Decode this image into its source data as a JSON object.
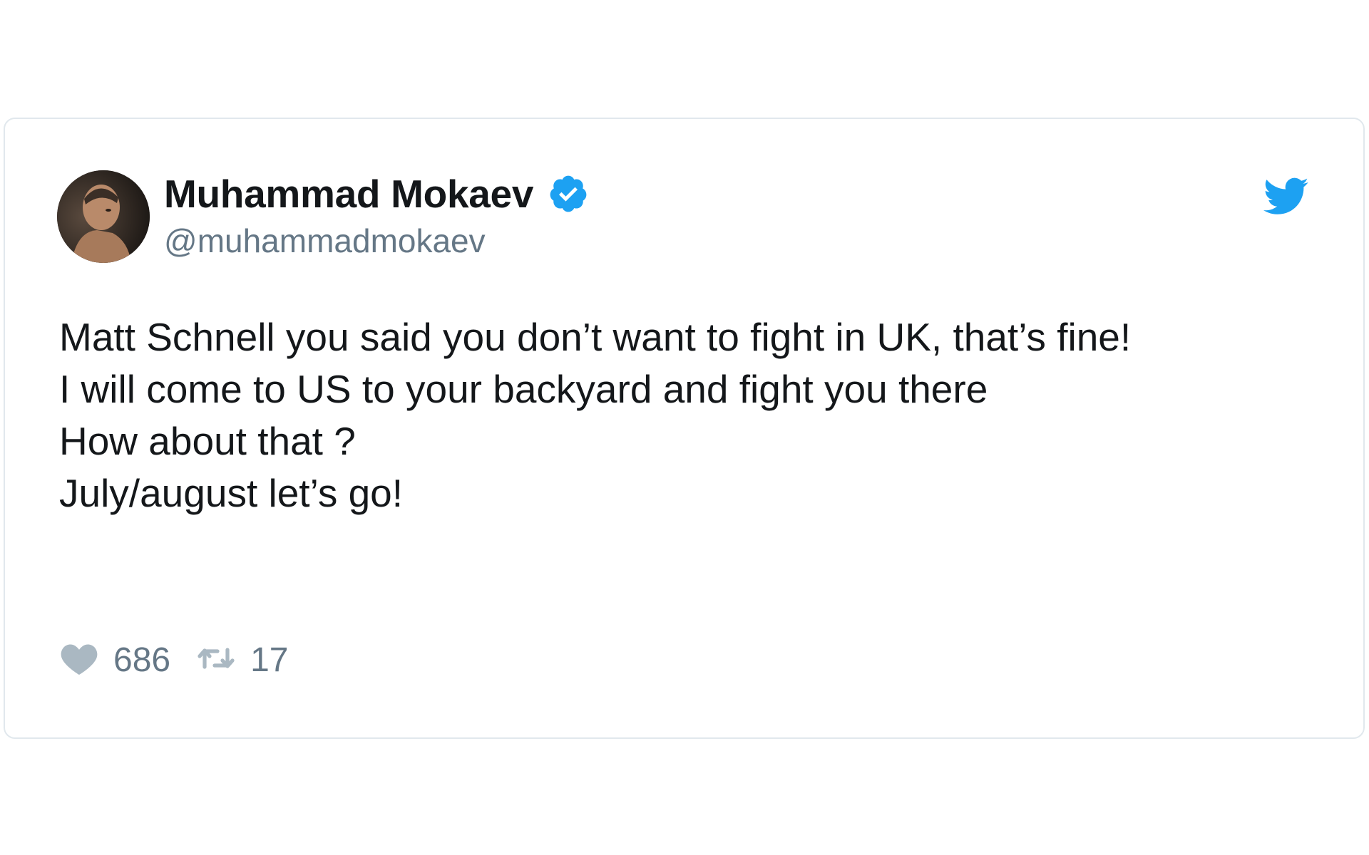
{
  "tweet": {
    "author": {
      "name": "Muhammad Mokaev",
      "handle": "@muhammadmokaev",
      "verified": true,
      "avatar_icon": "avatar-photo"
    },
    "text_lines": [
      "Matt Schnell you said you don’t want to fight in UK, that’s fine!",
      "I will come to US to your backyard and fight you there",
      "How about that ?",
      "July/august let’s go!"
    ],
    "likes": "686",
    "retweets": "17",
    "brand_icon": "twitter-bird-icon"
  },
  "colors": {
    "accent": "#1da1f2",
    "text": "#14171a",
    "muted": "#657786",
    "border": "#e1e8ed",
    "icon_gray": "#aab8c2"
  }
}
